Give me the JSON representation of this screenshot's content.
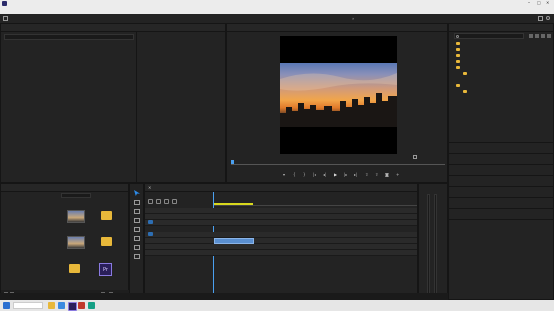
{
  "app": {
    "title": "",
    "accent": "#2d8ceb"
  },
  "menu": [],
  "workspaces": [],
  "effect_controls": {
    "tabs": [],
    "search_placeholder": ""
  },
  "program_monitor": {
    "title": "",
    "timecode": "",
    "fit": "",
    "quality": "",
    "duration": ""
  },
  "project": {
    "tabs": [],
    "path": "",
    "items": [
      {
        "name": "",
        "kind": "thumb"
      },
      {
        "name": "",
        "kind": "folder"
      },
      {
        "name": "",
        "kind": "thumb"
      },
      {
        "name": "",
        "kind": "folder"
      },
      {
        "name": "",
        "kind": "thumb"
      },
      {
        "name": "",
        "kind": "premiere"
      },
      {
        "name": "",
        "kind": "folder"
      }
    ],
    "meta_labels": []
  },
  "timeline": {
    "title": "",
    "timecode": "",
    "ruler": [],
    "video_tracks": [],
    "audio_tracks": [],
    "clip_label": "",
    "master": ""
  },
  "effects_panel": {
    "title": "",
    "search_placeholder": "",
    "tree": [],
    "sections": []
  },
  "taskbar": {
    "time": "",
    "date": ""
  },
  "status_text": "",
  "watermark": ""
}
